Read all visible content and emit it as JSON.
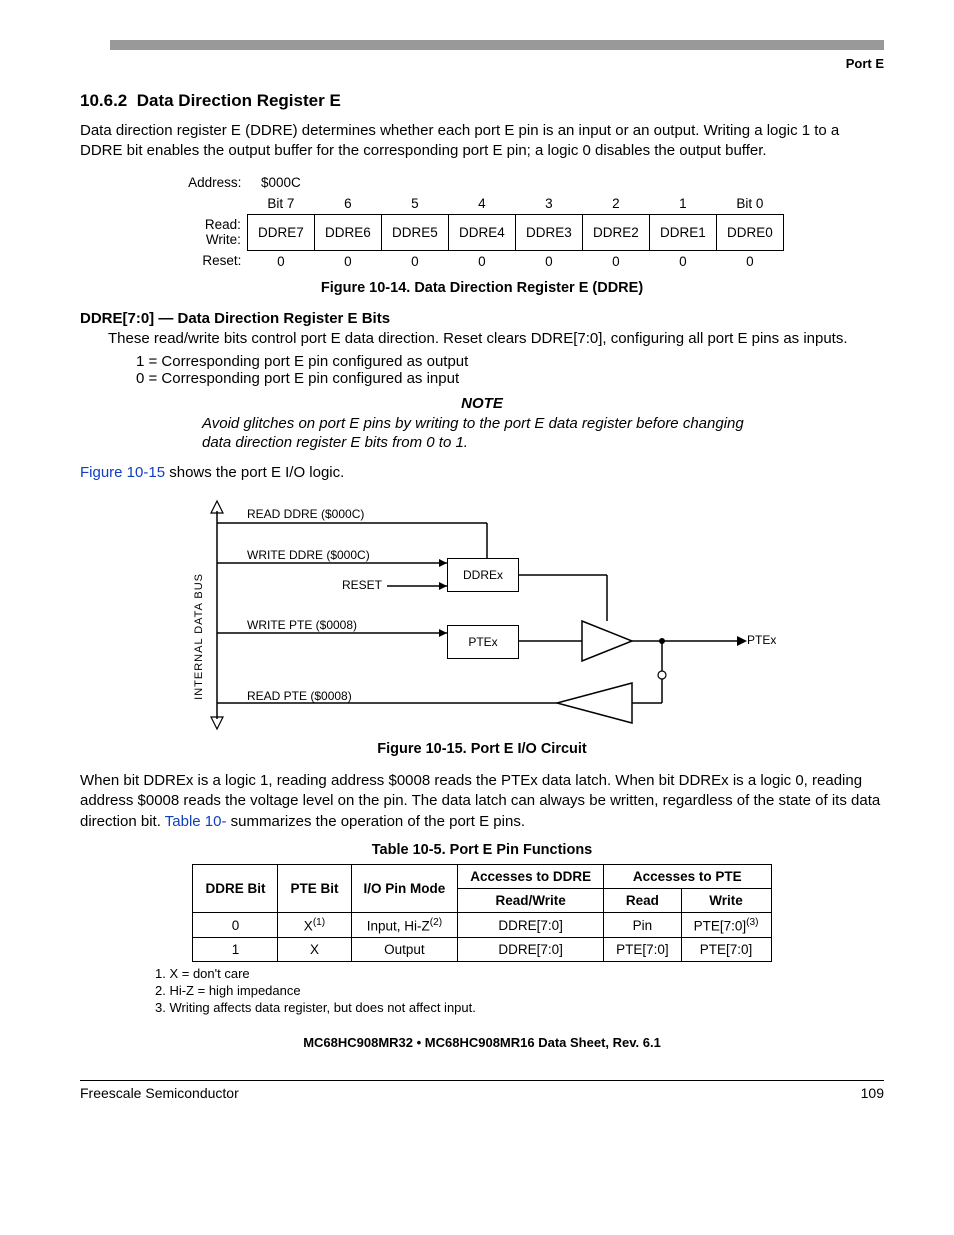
{
  "header": {
    "section_tag": "Port E"
  },
  "section": {
    "number": "10.6.2",
    "title": "Data Direction Register E",
    "intro": "Data direction register E (DDRE) determines whether each port E pin is an input or an output. Writing a logic 1 to a DDRE bit enables the output buffer for the corresponding port E pin; a logic 0 disables the output buffer."
  },
  "register": {
    "address_label": "Address:",
    "address": "$000C",
    "bit_headers": [
      "Bit 7",
      "6",
      "5",
      "4",
      "3",
      "2",
      "1",
      "Bit 0"
    ],
    "rw_label_read": "Read:",
    "rw_label_write": "Write:",
    "bits": [
      "DDRE7",
      "DDRE6",
      "DDRE5",
      "DDRE4",
      "DDRE3",
      "DDRE2",
      "DDRE1",
      "DDRE0"
    ],
    "reset_label": "Reset:",
    "reset": [
      "0",
      "0",
      "0",
      "0",
      "0",
      "0",
      "0",
      "0"
    ],
    "caption": "Figure 10-14. Data Direction Register E (DDRE)"
  },
  "bitdesc": {
    "heading": "DDRE[7:0] — Data Direction Register E Bits",
    "body": "These read/write bits control port E data direction. Reset clears DDRE[7:0], configuring all port E pins as inputs.",
    "v1": "1 = Corresponding port E pin configured as output",
    "v0": "0 = Corresponding port E pin configured as input"
  },
  "note": {
    "head": "NOTE",
    "body": "Avoid glitches on port E pins by writing to the port E data register before changing data direction register E bits from 0 to 1."
  },
  "para_after_note_prefix": "",
  "xref_fig15": "Figure 10-15",
  "para_after_note_suffix": " shows the port E I/O logic.",
  "circuit": {
    "bus": "INTERNAL DATA BUS",
    "l1": "READ DDRE ($000C)",
    "l2": "WRITE DDRE ($000C)",
    "l3": "RESET",
    "l4": "WRITE PTE ($0008)",
    "l5": "READ PTE ($0008)",
    "b1": "DDREx",
    "b2": "PTEx",
    "out": "PTEx",
    "caption": "Figure 10-15. Port E I/O Circuit"
  },
  "para_after_fig": {
    "t1": "When bit DDREx is a logic 1, reading address $0008 reads the PTEx data latch. When bit DDREx is a logic 0, reading address $0008 reads the voltage level on the pin. The data latch can always be written, regardless of the state of its data direction bit. ",
    "xref": "Table 10-",
    "t2": "   summarizes the operation of the port E pins."
  },
  "table": {
    "caption": "Table 10-5. Port E Pin Functions",
    "h_ddre": "DDRE Bit",
    "h_pte": "PTE Bit",
    "h_mode": "I/O Pin Mode",
    "h_acc_ddre": "Accesses to DDRE",
    "h_acc_pte": "Accesses to PTE",
    "h_rw": "Read/Write",
    "h_r": "Read",
    "h_w": "Write",
    "rows": [
      {
        "ddre": "0",
        "pte": "X",
        "pte_sup": "(1)",
        "mode": "Input, Hi-Z",
        "mode_sup": "(2)",
        "rw": "DDRE[7:0]",
        "r": "Pin",
        "w": "PTE[7:0]",
        "w_sup": "(3)"
      },
      {
        "ddre": "1",
        "pte": "X",
        "pte_sup": "",
        "mode": "Output",
        "mode_sup": "",
        "rw": "DDRE[7:0]",
        "r": "PTE[7:0]",
        "w": "PTE[7:0]",
        "w_sup": ""
      }
    ],
    "notes": [
      "1. X = don't care",
      "2. Hi-Z = high impedance",
      "3. Writing affects data register, but does not affect input."
    ]
  },
  "footer": {
    "doc": "MC68HC908MR32 • MC68HC908MR16 Data Sheet, Rev. 6.1",
    "left": "Freescale Semiconductor",
    "right": "109"
  }
}
